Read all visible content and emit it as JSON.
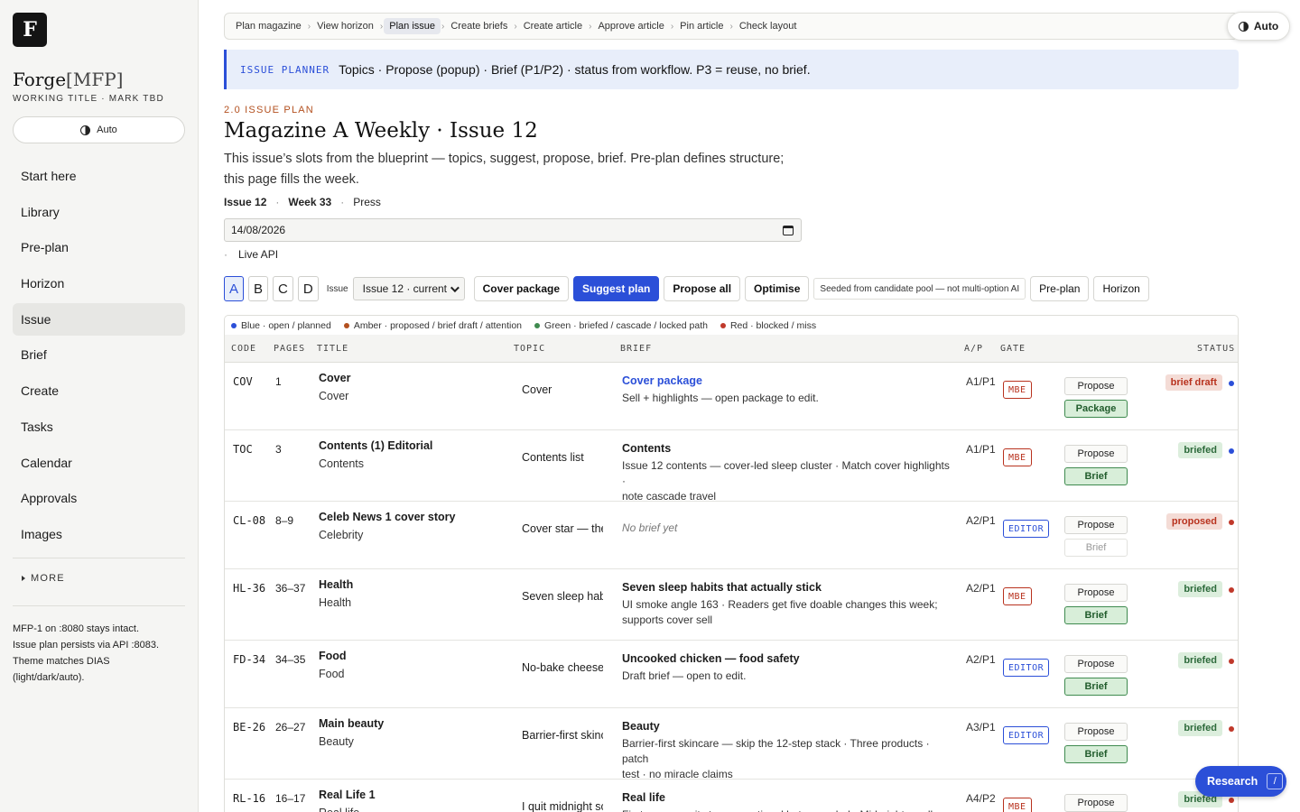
{
  "sidebar": {
    "logo_letter": "F",
    "brand_main": "Forge",
    "brand_suffix": "[MFP]",
    "subtitle": "WORKING TITLE · MARK TBD",
    "theme_label": "Auto",
    "nav": [
      "Start here",
      "Library",
      "Pre-plan",
      "Horizon",
      "Issue",
      "Brief",
      "Create",
      "Tasks",
      "Calendar",
      "Approvals",
      "Images"
    ],
    "active_nav": "Issue",
    "more_label": "MORE",
    "note_lines": [
      "MFP-1 on :8080 stays intact.",
      "Issue plan persists via API :8083.",
      "Theme matches DIAS",
      "(light/dark/auto)."
    ]
  },
  "breadcrumbs": [
    "Plan magazine",
    "View horizon",
    "Plan issue",
    "Create briefs",
    "Create article",
    "Approve article",
    "Pin article",
    "Check layout"
  ],
  "active_crumb": "Plan issue",
  "theme_pill": "Auto",
  "planner": {
    "tag": "ISSUE PLANNER",
    "text": "Topics · Propose (popup) · Brief (P1/P2) · status from workflow. P3 = reuse, no brief."
  },
  "header": {
    "section": "2.0 ISSUE PLAN",
    "title": "Magazine A Weekly · Issue 12",
    "desc_line1": "This issue’s slots from the blueprint — topics, suggest, propose, brief. Pre-plan defines structure;",
    "desc_line2": "this page fills the week.",
    "issue": "Issue 12",
    "week": "Week 33",
    "press": "Press",
    "date": "14/08/2026",
    "live": "Live API"
  },
  "toolbar": {
    "options": [
      "A",
      "B",
      "C",
      "D"
    ],
    "active_option": "A",
    "issue_label": "Issue",
    "issue_select": "Issue 12 · current",
    "cover_package": "Cover package",
    "suggest_plan": "Suggest plan",
    "propose_all": "Propose all",
    "optimise": "Optimise",
    "seed_note": "Seeded from candidate pool — not multi-option AI",
    "preplan": "Pre-plan",
    "horizon": "Horizon"
  },
  "legend": [
    {
      "color": "#2b4fd8",
      "label": "Blue · open / planned"
    },
    {
      "color": "#b3501f",
      "label": "Amber · proposed / brief draft / attention"
    },
    {
      "color": "#3f8a4f",
      "label": "Green · briefed / cascade / locked path"
    },
    {
      "color": "#c0392b",
      "label": "Red · blocked / miss"
    }
  ],
  "columns": {
    "code": "CODE",
    "pages": "PAGES",
    "title": "TITLE",
    "topic": "TOPIC",
    "brief": "BRIEF",
    "ap": "A/P",
    "gate": "GATE",
    "status": "STATUS"
  },
  "rows": [
    {
      "code": "COV",
      "pages": "1",
      "title": "Cover",
      "sub": "Cover",
      "topic": "Cover",
      "brief_title": "Cover package",
      "brief_link": true,
      "brief_lines": [
        "Sell + highlights — open package to edit."
      ],
      "ap": "A1/P1",
      "gate": "MBE",
      "propose": "Propose",
      "action": "Package",
      "action_enabled": true,
      "status": "brief draft",
      "status_kind": "draft",
      "dot": "#2b4fd8",
      "height": 75
    },
    {
      "code": "TOC",
      "pages": "3",
      "title": "Contents (1) Editorial",
      "sub": "Contents",
      "topic": "Contents list",
      "brief_title": "Contents",
      "brief_link": false,
      "brief_lines": [
        "Issue 12 contents — cover-led sleep cluster · Match cover highlights ·",
        "note cascade travel"
      ],
      "ap": "A1/P1",
      "gate": "MBE",
      "propose": "Propose",
      "action": "Brief",
      "action_enabled": true,
      "status": "briefed",
      "status_kind": "briefed",
      "dot": "#2b4fd8",
      "height": 79
    },
    {
      "code": "CL-08",
      "pages": "8–9",
      "title": "Celeb News 1 cover story",
      "sub": "Celebrity",
      "topic": "Cover star — the",
      "brief_title": "",
      "brief_empty": "No brief yet",
      "brief_lines": [],
      "ap": "A2/P1",
      "gate": "EDITOR",
      "propose": "Propose",
      "action": "Brief",
      "action_enabled": false,
      "status": "proposed",
      "status_kind": "proposed",
      "dot": "#c0392b",
      "height": 75
    },
    {
      "code": "HL-36",
      "pages": "36–37",
      "title": "Health",
      "sub": "Health",
      "topic": "Seven sleep habi",
      "brief_title": "Seven sleep habits that actually stick",
      "brief_link": false,
      "brief_lines": [
        "UI smoke angle 163 · Readers get five doable changes this week;",
        "supports cover sell"
      ],
      "ap": "A2/P1",
      "gate": "MBE",
      "propose": "Propose",
      "action": "Brief",
      "action_enabled": true,
      "status": "briefed",
      "status_kind": "briefed",
      "dot": "#c0392b",
      "height": 79
    },
    {
      "code": "FD-34",
      "pages": "34–35",
      "title": "Food",
      "sub": "Food",
      "topic": "No-bake cheesec",
      "brief_title": "Uncooked chicken — food safety",
      "brief_link": false,
      "brief_lines": [
        "Draft brief — open to edit."
      ],
      "ap": "A2/P1",
      "gate": "EDITOR",
      "propose": "Propose",
      "action": "Brief",
      "action_enabled": true,
      "status": "briefed",
      "status_kind": "briefed",
      "dot": "#c0392b",
      "height": 75
    },
    {
      "code": "BE-26",
      "pages": "26–27",
      "title": "Main beauty",
      "sub": "Beauty",
      "topic": "Barrier-first skinc",
      "brief_title": "Beauty",
      "brief_link": false,
      "brief_lines": [
        "Barrier-first skincare — skip the 12-step stack · Three products · patch",
        "test · no miracle claims"
      ],
      "ap": "A3/P1",
      "gate": "EDITOR",
      "propose": "Propose",
      "action": "Brief",
      "action_enabled": true,
      "status": "briefed",
      "status_kind": "briefed",
      "dot": "#c0392b",
      "height": 79
    },
    {
      "code": "RL-16",
      "pages": "16–17",
      "title": "Real Life 1",
      "sub": "Real life",
      "topic": "I quit midnight sc",
      "brief_title": "Real life",
      "brief_link": false,
      "brief_lines": [
        "First-person quit story · emotional but grounded · Mid-night scroll"
      ],
      "ap": "A4/P2",
      "gate": "MBE",
      "propose": "Propose",
      "action": "Brief",
      "action_enabled": true,
      "status": "briefed",
      "status_kind": "briefed",
      "dot": "#c0392b",
      "height": 75
    }
  ],
  "research": {
    "label": "Research",
    "shortcut": "/"
  }
}
